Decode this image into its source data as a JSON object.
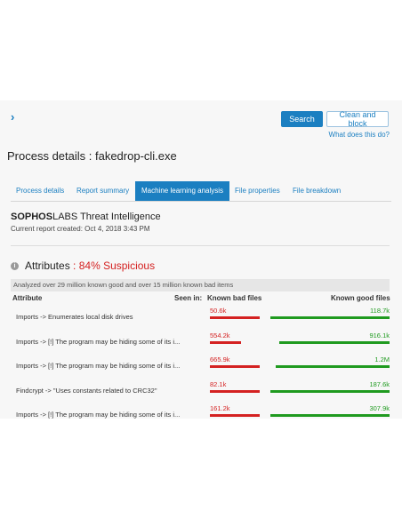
{
  "header": {
    "chevron": "›",
    "search_label": "Search",
    "clean_label": "Clean and block",
    "what_link": "What does this do?"
  },
  "page_title": "Process details : fakedrop-cli.exe",
  "tabs": [
    {
      "label": "Process details",
      "active": false
    },
    {
      "label": "Report summary",
      "active": false
    },
    {
      "label": "Machine learning analysis",
      "active": true
    },
    {
      "label": "File properties",
      "active": false
    },
    {
      "label": "File breakdown",
      "active": false
    }
  ],
  "intel": {
    "brand_bold": "SOPHOS",
    "brand_rest": "LABS Threat Intelligence",
    "created": "Current report created: Oct 4, 2018 3:43 PM"
  },
  "attributes": {
    "title": "Attributes",
    "separator": " : ",
    "score": "84% Suspicious",
    "info_glyph": "i",
    "analyzed": "Analyzed over 29 million known good and over 15 million known bad items",
    "col_attribute": "Attribute",
    "col_seen": "Seen in:",
    "col_bad": "Known bad files",
    "col_good": "Known good files"
  },
  "colors": {
    "accent": "#1b7fc1",
    "bad": "#d42121",
    "good": "#1f9a1f"
  },
  "rows": [
    {
      "label": "Imports -> Enumerates local disk drives",
      "bad": "50.6k",
      "good": "118.7k",
      "bad_fill": 0.97,
      "good_fill": 0.97
    },
    {
      "label": "Imports -> [!] The program may be hiding some of its i...",
      "bad": "554.2k",
      "good": "916.1k",
      "bad_fill": 0.6,
      "good_fill": 0.9
    },
    {
      "label": "Imports -> [!] The program may be hiding some of its i...",
      "bad": "665.9k",
      "good": "1.2M",
      "bad_fill": 0.97,
      "good_fill": 0.93
    },
    {
      "label": "Findcrypt -> \"Uses constants related to CRC32\"",
      "bad": "82.1k",
      "good": "187.6k",
      "bad_fill": 0.97,
      "good_fill": 0.97
    },
    {
      "label": "Imports -> [!] The program may be hiding some of its i...",
      "bad": "161.2k",
      "good": "307.9k",
      "bad_fill": 0.97,
      "good_fill": 0.97
    }
  ]
}
